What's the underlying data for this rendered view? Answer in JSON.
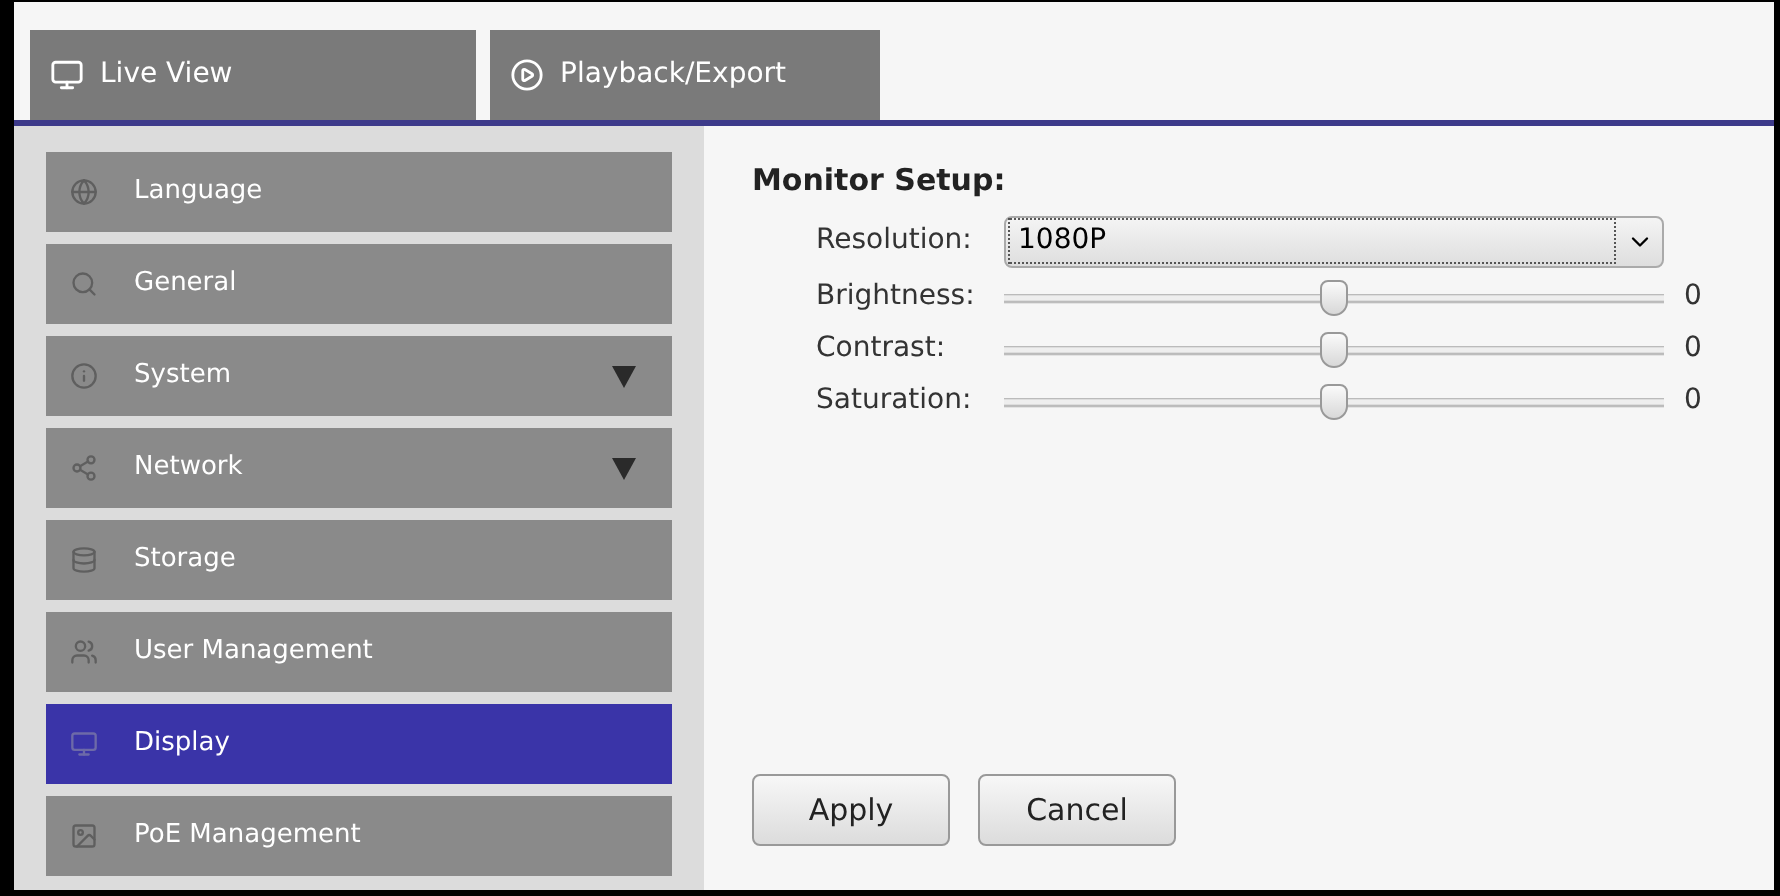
{
  "tabs": [
    {
      "label": "Live View"
    },
    {
      "label": "Playback/Export"
    }
  ],
  "sidebar": {
    "items": [
      {
        "label": "Language",
        "expandable": false,
        "selected": false
      },
      {
        "label": "General",
        "expandable": false,
        "selected": false
      },
      {
        "label": "System",
        "expandable": true,
        "selected": false
      },
      {
        "label": "Network",
        "expandable": true,
        "selected": false
      },
      {
        "label": "Storage",
        "expandable": false,
        "selected": false
      },
      {
        "label": "User Management",
        "expandable": false,
        "selected": false
      },
      {
        "label": "Display",
        "expandable": false,
        "selected": true
      },
      {
        "label": "PoE Management",
        "expandable": false,
        "selected": false
      }
    ]
  },
  "content": {
    "title": "Monitor Setup:",
    "resolution": {
      "label": "Resolution:",
      "value": "1080P"
    },
    "sliders": [
      {
        "label": "Brightness:",
        "level": 0.5,
        "reading": "0"
      },
      {
        "label": "Contrast:",
        "level": 0.5,
        "reading": "0"
      },
      {
        "label": "Saturation:",
        "level": 0.5,
        "reading": "0"
      }
    ],
    "buttons": [
      "Apply",
      "Cancel"
    ]
  }
}
